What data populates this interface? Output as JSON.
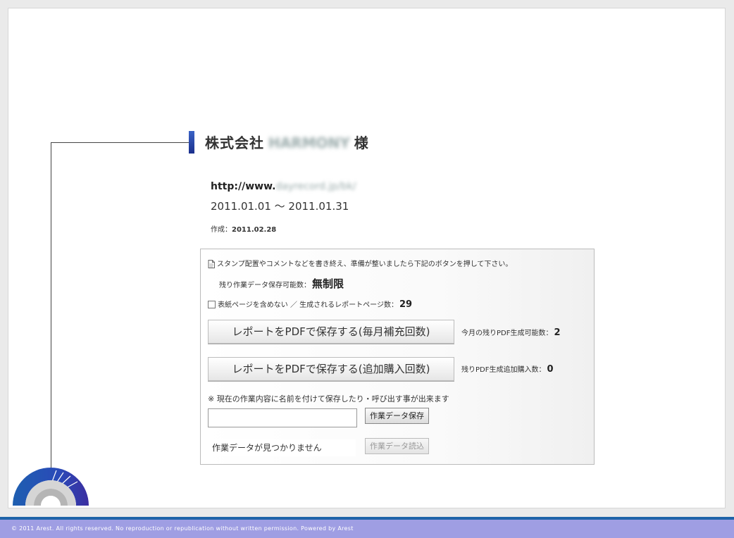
{
  "header": {
    "company_prefix": "株式会社",
    "company_name": "HARMONY",
    "honorific": "様"
  },
  "site": {
    "url_prefix": "http://www.",
    "url_rest": "dayrecord.jp/bk/"
  },
  "period": "2011.01.01 〜 2011.01.31",
  "created": {
    "label": "作成：",
    "date": "2011.02.28"
  },
  "panel": {
    "note": "スタンプ配置やコメントなどを書き終え、準備が整いましたら下記のボタンを押して下さい。",
    "remaining_label": "残り作業データ保存可能数：",
    "remaining_value": "無制限",
    "cover_label": "表紙ページを含めない ／ 生成されるレポートページ数：",
    "cover_checked": false,
    "page_count": "29",
    "btn_monthly": "レポートをPDFで保存する(毎月補充回数)",
    "monthly_label": "今月の残りPDF生成可能数：",
    "monthly_count": "2",
    "btn_extra": "レポートをPDFで保存する(追加購入回数)",
    "extra_label": "残りPDF生成追加購入数：",
    "extra_count": "0",
    "save_note": "※ 現在の作業内容に名前を付けて保存したり・呼び出す事が出来ます",
    "name_input_value": "",
    "btn_save": "作業データ保存",
    "not_found": "作業データが見つかりません",
    "btn_load": "作業データ読込"
  },
  "footer": {
    "copyright": "© 2011 Arest. All rights reserved. No reproduction or republication without written permission. Powered by Arest"
  },
  "colors": {
    "accent_bar": "#2b46b0",
    "footer_bg": "#9f9ee3",
    "footer_stripe": "#1e63a8"
  }
}
